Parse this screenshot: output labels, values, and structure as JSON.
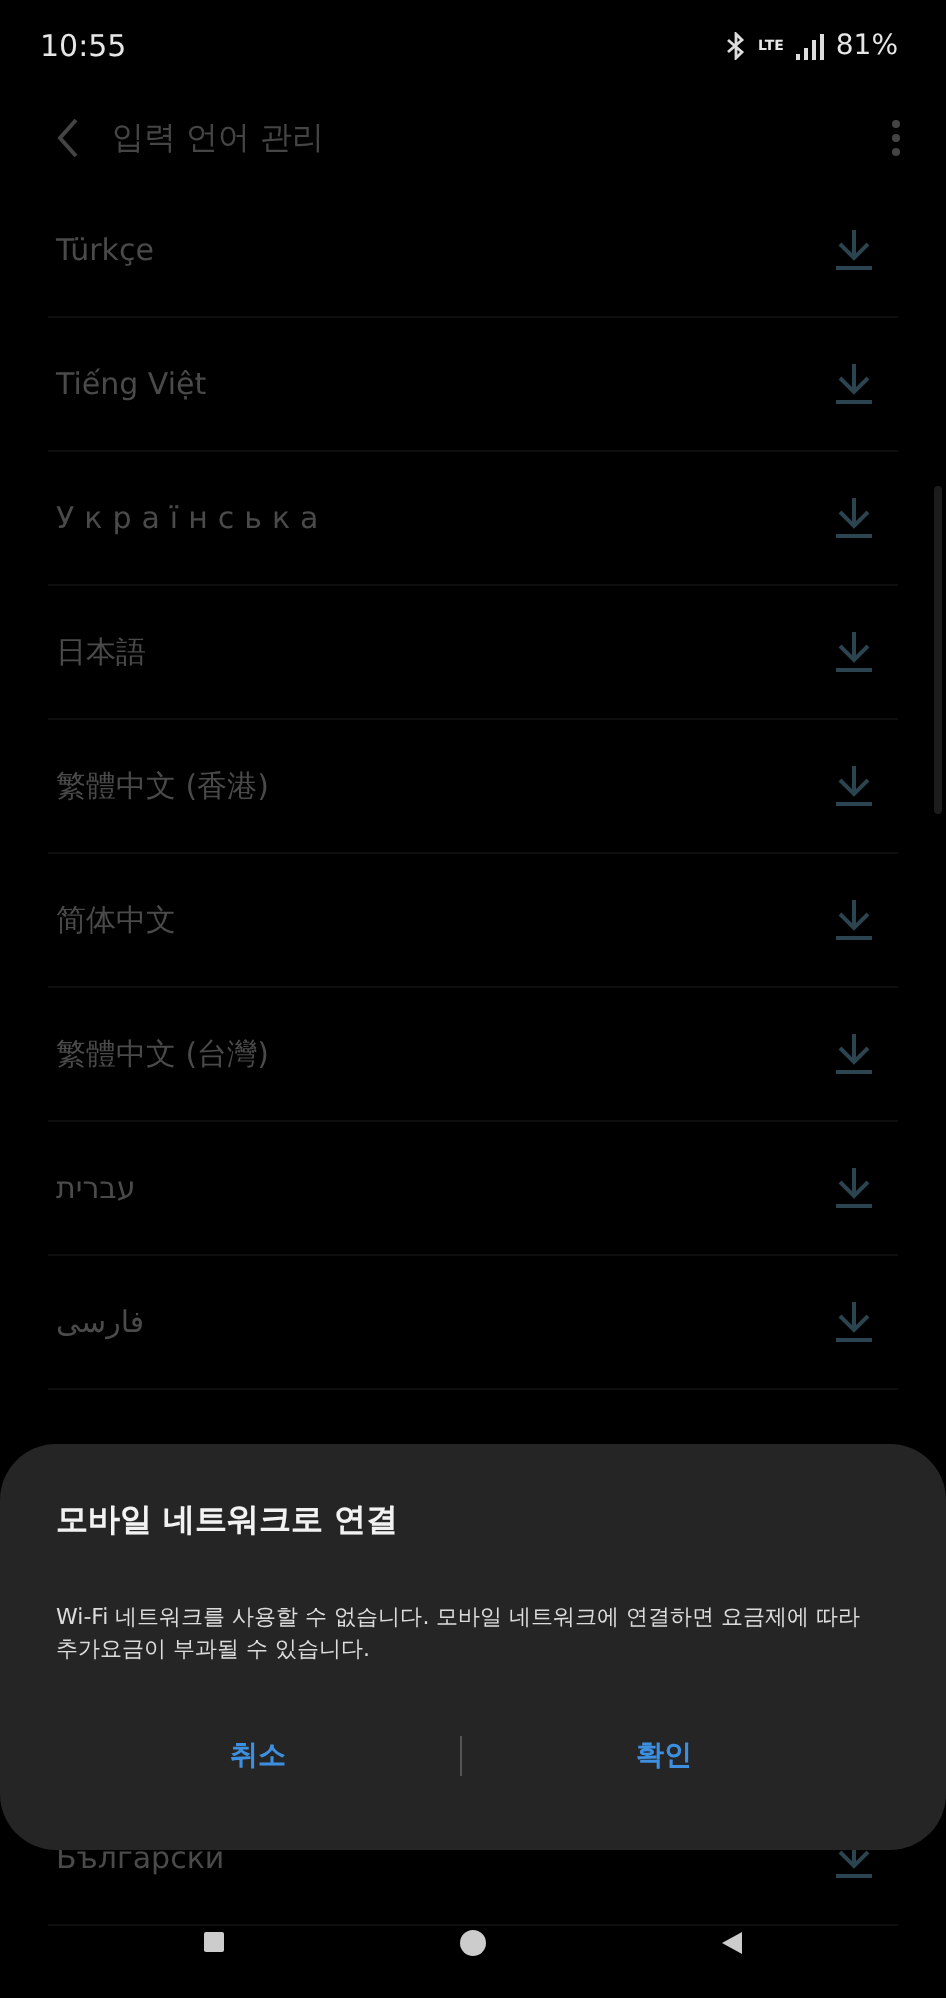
{
  "status_bar": {
    "time": "10:55",
    "network": "LTE",
    "battery": "81%"
  },
  "toolbar": {
    "title": "입력 언어 관리"
  },
  "languages": [
    {
      "name": "Türkçe"
    },
    {
      "name": "Tiếng Việt"
    },
    {
      "name": "Українська"
    },
    {
      "name": "日本語"
    },
    {
      "name": "繁體中文 (香港)"
    },
    {
      "name": "简体中文"
    },
    {
      "name": "繁體中文 (台灣)"
    },
    {
      "name": "עברית"
    },
    {
      "name": "فارسی"
    }
  ],
  "languages_below_dialog": [
    {
      "name": "Български"
    }
  ],
  "dialog": {
    "title": "모바일 네트워크로 연결",
    "message": "Wi-Fi 네트워크를 사용할 수 없습니다. 모바일 네트워크에 연결하면 요금제에 따라 추가요금이 부과될 수 있습니다.",
    "buttons": [
      "취소",
      "확인"
    ]
  }
}
